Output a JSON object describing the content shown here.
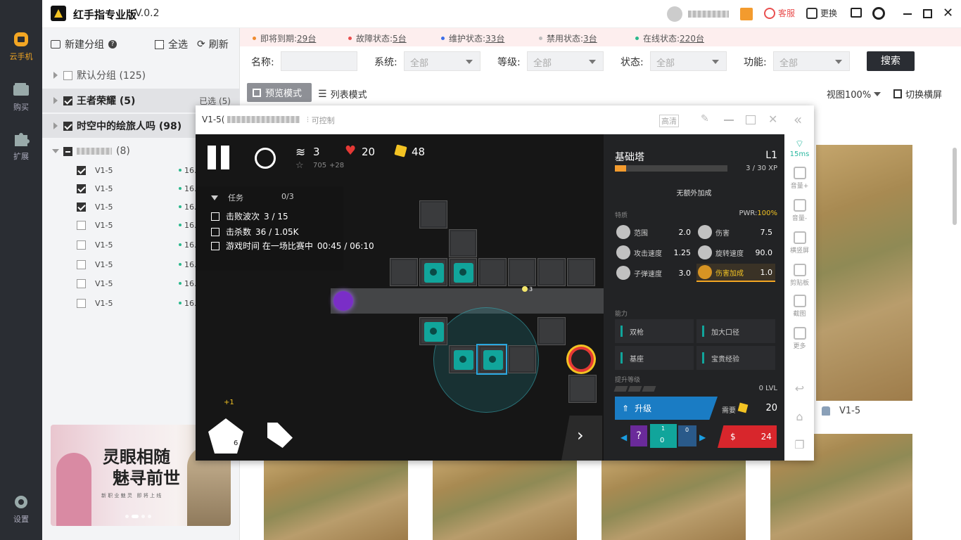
{
  "app": {
    "title": "红手指专业版",
    "version": "V.0.2"
  },
  "rail": {
    "items": [
      {
        "label": "云手机",
        "icon": "cloud-phone-icon"
      },
      {
        "label": "购买",
        "icon": "wallet-icon"
      },
      {
        "label": "扩展",
        "icon": "puzzle-icon"
      },
      {
        "label": "设置",
        "icon": "gear-icon"
      }
    ]
  },
  "titlebar": {
    "service": "客服",
    "switch": "更换"
  },
  "groups": {
    "new_group": "新建分组",
    "select_all": "全选",
    "refresh": "刷新",
    "items": [
      {
        "label": "默认分组 (125)"
      },
      {
        "label": "王者荣耀 (5)",
        "extra": "已选 (5)"
      },
      {
        "label": "时空中的绘旅人吗 (98)"
      },
      {
        "label": "(8)"
      }
    ],
    "devices": [
      {
        "name": "V1-5",
        "ip": "16."
      },
      {
        "name": "V1-5",
        "ip": "16."
      },
      {
        "name": "V1-5",
        "ip": "16."
      },
      {
        "name": "V1-5",
        "ip": "16."
      },
      {
        "name": "V1-5",
        "ip": "16."
      },
      {
        "name": "V1-5",
        "ip": "16."
      },
      {
        "name": "V1-5",
        "ip": "16."
      },
      {
        "name": "V1-5",
        "ip": "16."
      }
    ]
  },
  "banner": {
    "title_line1": "灵眼相随",
    "title_line2": "魅寻前世",
    "sub": "新 职 业 魅 灵   即 将 上 线"
  },
  "status": [
    {
      "label": "即将到期:",
      "value": "29台",
      "color": "#f08a2e"
    },
    {
      "label": "故障状态:",
      "value": "5台",
      "color": "#e94f4f"
    },
    {
      "label": "维护状态:",
      "value": "33台",
      "color": "#3b6ee8"
    },
    {
      "label": "禁用状态:",
      "value": "3台",
      "color": "#bbbbbb"
    },
    {
      "label": "在线状态:",
      "value": "220台",
      "color": "#2ab88c"
    }
  ],
  "filters": {
    "name_label": "名称:",
    "system_label": "系统:",
    "system_value": "全部",
    "level_label": "等级:",
    "level_value": "全部",
    "state_label": "状态:",
    "state_value": "全部",
    "function_label": "功能:",
    "function_value": "全部",
    "search": "搜索"
  },
  "view": {
    "preview_mode": "预览模式",
    "list_mode": "列表模式",
    "zoom": "视图100%",
    "orientation": "切换横屏"
  },
  "phone": {
    "title": "V1-5(",
    "controllable": "可控制",
    "hd": "高清",
    "ping": "15ms",
    "tools": [
      {
        "label": "音量+",
        "icon": "volume-up-icon"
      },
      {
        "label": "音量-",
        "icon": "volume-down-icon"
      },
      {
        "label": "横竖屏",
        "icon": "rotate-icon"
      },
      {
        "label": "剪贴板",
        "icon": "clipboard-icon"
      },
      {
        "label": "截图",
        "icon": "crop-icon"
      },
      {
        "label": "更多",
        "icon": "more-icon"
      }
    ]
  },
  "game": {
    "wave": "3",
    "hearts": "20",
    "coins": "48",
    "stars": "705",
    "stars_plus": "+28",
    "tasks_title": "任务",
    "tasks_progress": "0/3",
    "tasks": [
      {
        "label": "击败波次",
        "progress": "3 / 15"
      },
      {
        "label": "击杀数",
        "progress": "36 / 1.05K"
      },
      {
        "label": "游戏时间 在一场比赛中",
        "progress": "00:45 / 06:10"
      }
    ],
    "bonus_plus": "+1",
    "base_count": "6",
    "wave_tag": "3",
    "tower": {
      "name": "基础塔",
      "level": "L1",
      "xp": "3 / 30 XP",
      "xp_fraction": 0.1,
      "no_bonus": "无额外加成",
      "traits_label": "特质",
      "pwr_label": "PWR:",
      "pwr_value": "100%",
      "stats": [
        {
          "label": "范围",
          "value": "2.0"
        },
        {
          "label": "伤害",
          "value": "7.5"
        },
        {
          "label": "攻击速度",
          "value": "1.25"
        },
        {
          "label": "旋转速度",
          "value": "90.0"
        },
        {
          "label": "子弹速度",
          "value": "3.0"
        },
        {
          "label": "伤害加成",
          "value": "1.0"
        }
      ],
      "abilities_label": "能力",
      "abilities": [
        "双枪",
        "加大口径",
        "基座",
        "宝贵经验"
      ],
      "upgrade_label": "提升等级",
      "lvl": "0 LVL",
      "upgrade_btn": "升级",
      "need_label": "需要",
      "need_value": "20",
      "sell_value": "24",
      "card_num": "1",
      "card_val": "0",
      "card_num2": "0"
    }
  },
  "thumbs": {
    "label": "V1-5"
  }
}
